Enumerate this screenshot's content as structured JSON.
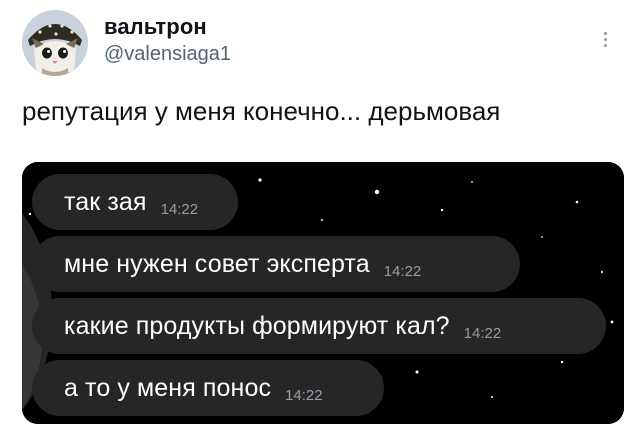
{
  "tweet": {
    "display_name": "вальтрон",
    "handle": "@valensiaga1",
    "text": "репутация у меня конечно... дерьмовая",
    "avatar_icon": "cat-avatar-icon",
    "more_icon": "more-vertical-icon"
  },
  "chat": {
    "messages": [
      {
        "text": "так зая",
        "time": "14:22"
      },
      {
        "text": "мне нужен совет эксперта",
        "time": "14:22"
      },
      {
        "text": "какие продукты формируют кал?",
        "time": "14:22"
      },
      {
        "text": "а то у меня понос",
        "time": "14:22"
      }
    ]
  },
  "colors": {
    "name": "#0f1419",
    "handle": "#536471",
    "chat_background": "#000000",
    "bubble": "#262628",
    "bubble_text": "#ffffff",
    "bubble_time": "#9c9ca0"
  }
}
